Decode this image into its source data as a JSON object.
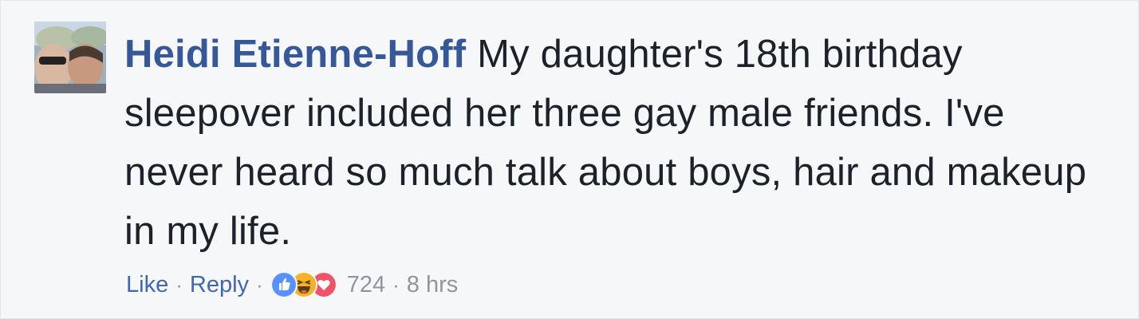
{
  "comment": {
    "author": "Heidi Etienne-Hoff",
    "text": "My daughter's 18th birthday sleepover included her three gay male friends. I've never heard so much talk about boys, hair and makeup in my life."
  },
  "actions": {
    "like_label": "Like",
    "reply_label": "Reply",
    "separator": "·",
    "reaction_count": "724",
    "timestamp": "8 hrs"
  },
  "reactions": [
    "like-icon",
    "haha-icon",
    "love-icon"
  ],
  "colors": {
    "background": "#f6f7f9",
    "author": "#365899",
    "link": "#4267b2",
    "meta": "#90949c",
    "text": "#1d2129",
    "like": "#5890ff",
    "haha": "#f7b125",
    "love": "#f25268"
  }
}
